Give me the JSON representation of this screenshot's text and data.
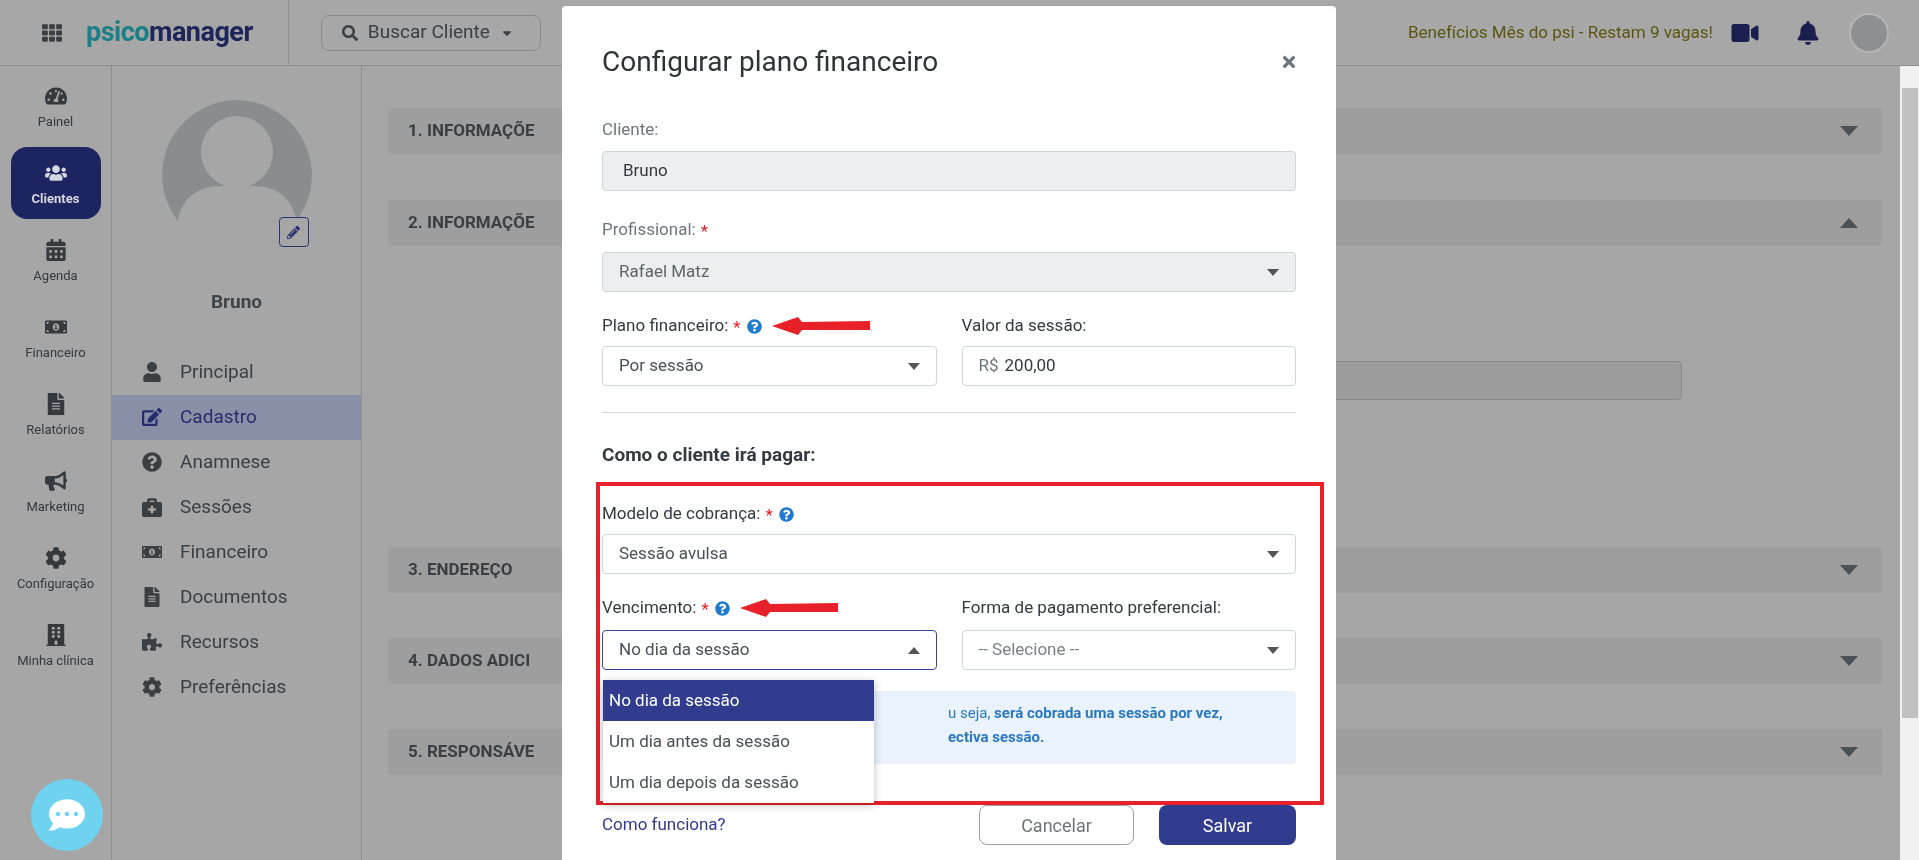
{
  "top_bar": {
    "logo": {
      "part_1": "psico",
      "part_2": "manager"
    },
    "search_button": "Buscar Cliente",
    "promo": "Benefícios Mês do psi - Restam 9 vagas!"
  },
  "nav_rail": [
    {
      "kind": "gauge",
      "label": "Painel",
      "selected": false
    },
    {
      "kind": "users",
      "label": "Clientes",
      "selected": true
    },
    {
      "kind": "calendar",
      "label": "Agenda",
      "selected": false
    },
    {
      "kind": "money",
      "label": "Financeiro",
      "selected": false
    },
    {
      "kind": "file",
      "label": "Relatórios",
      "selected": false
    },
    {
      "kind": "megaphone",
      "label": "Marketing",
      "selected": false
    },
    {
      "kind": "gear",
      "label": "Configuração",
      "selected": false
    },
    {
      "kind": "building",
      "label": "Minha clínica",
      "selected": false
    }
  ],
  "client": {
    "name": "Bruno"
  },
  "client_menu": [
    {
      "kind": "user",
      "label": "Principal",
      "selected": false
    },
    {
      "kind": "edit",
      "label": "Cadastro",
      "selected": true
    },
    {
      "kind": "question",
      "label": "Anamnese",
      "selected": false
    },
    {
      "kind": "medkit",
      "label": "Sessões",
      "selected": false
    },
    {
      "kind": "money",
      "label": "Financeiro",
      "selected": false
    },
    {
      "kind": "file",
      "label": "Documentos",
      "selected": false
    },
    {
      "kind": "puzzle",
      "label": "Recursos",
      "selected": false
    },
    {
      "kind": "gear",
      "label": "Preferências",
      "selected": false
    }
  ],
  "sections": [
    {
      "title": "1. INFORMAÇÕE",
      "expanded": false
    },
    {
      "title": "2. INFORMAÇÕE",
      "expanded": true
    },
    {
      "title": "3. ENDEREÇO",
      "expanded": false
    },
    {
      "title": "4. DADOS ADICI",
      "expanded": false
    },
    {
      "title": "5. RESPONSÁVE",
      "expanded": false
    }
  ],
  "modal": {
    "title": "Configurar plano financeiro",
    "client_field": {
      "label": "Cliente:",
      "value": "Bruno",
      "disabled": true
    },
    "professional_field": {
      "label": "Profissional:",
      "required_mark": "*",
      "value": "Rafael Matz",
      "disabled": true
    },
    "plan_field": {
      "label": "Plano financeiro:",
      "required_mark": "*",
      "help": true,
      "arrow": true,
      "value": "Por sessão"
    },
    "session_value_field": {
      "label": "Valor da sessão:",
      "prefix": "R$",
      "value": "200,00"
    },
    "payment_heading": "Como o cliente irá pagar:",
    "billing_model_field": {
      "label": "Modelo de cobrança:",
      "required_mark": "*",
      "help": true,
      "arrow": false,
      "value": "Sessão avulsa"
    },
    "due_field": {
      "label": "Vencimento:",
      "required_mark": "*",
      "help": true,
      "arrow": true,
      "value": "No dia da sessão",
      "expanded": true,
      "options": [
        {
          "label": "No dia da sessão",
          "selected": true
        },
        {
          "label": "Um dia antes da sessão",
          "selected": false
        },
        {
          "label": "Um dia depois da sessão",
          "selected": false
        }
      ]
    },
    "payment_method_field": {
      "label": "Forma de pagamento preferencial:",
      "placeholder": "-- Selecione --"
    },
    "info_lines": [
      "u seja, **será cobrada uma sessão por vez,**",
      "**ectiva sessão.**"
    ],
    "help_link": "Como funciona?",
    "cancel_button": "Cancelar",
    "save_button": "Salvar"
  }
}
